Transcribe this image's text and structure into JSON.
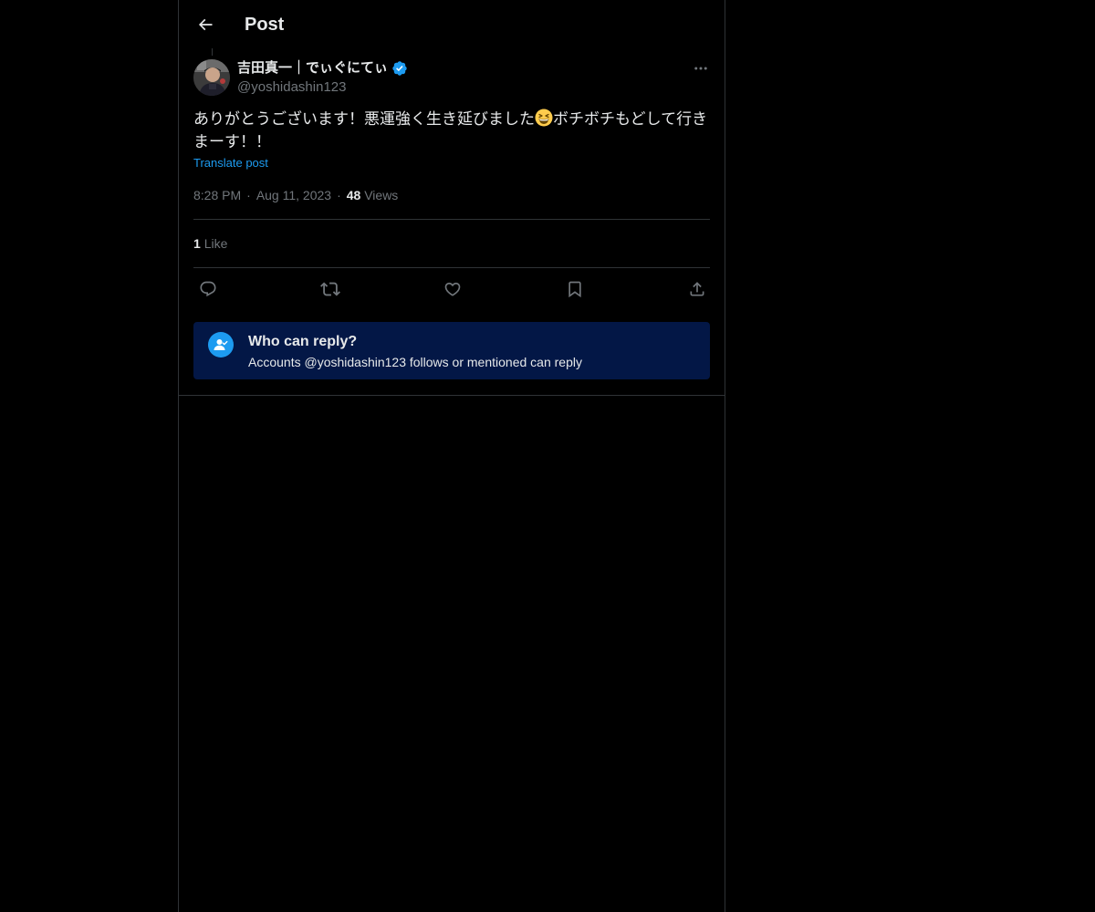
{
  "header": {
    "title": "Post",
    "back_icon": "arrow-left-icon"
  },
  "post": {
    "author_name": "吉田真一｜でぃぐにてぃ",
    "handle": "@yoshidashin123",
    "verified": true,
    "text_part1": "ありがとうございます！悪運強く生き延びました",
    "emoji": "grinning-squinting-face",
    "text_part2": "ボチボチもどして行きまーす！！",
    "translate_label": "Translate post",
    "time": "8:28 PM",
    "date": "Aug 11, 2023",
    "views_count": "48",
    "views_label": "Views",
    "likes_count": "1",
    "likes_label": "Like"
  },
  "actions": {
    "reply_icon": "reply-icon",
    "repost_icon": "repost-icon",
    "like_icon": "heart-icon",
    "bookmark_icon": "bookmark-icon",
    "share_icon": "share-icon"
  },
  "reply_restriction": {
    "title": "Who can reply?",
    "subtitle": "Accounts @yoshidashin123 follows or mentioned can reply"
  },
  "colors": {
    "background": "#000000",
    "text_primary": "#e7e9ea",
    "text_secondary": "#71767b",
    "accent": "#1d9bf0",
    "border": "#2f3336",
    "reply_box_bg": "#031746"
  }
}
